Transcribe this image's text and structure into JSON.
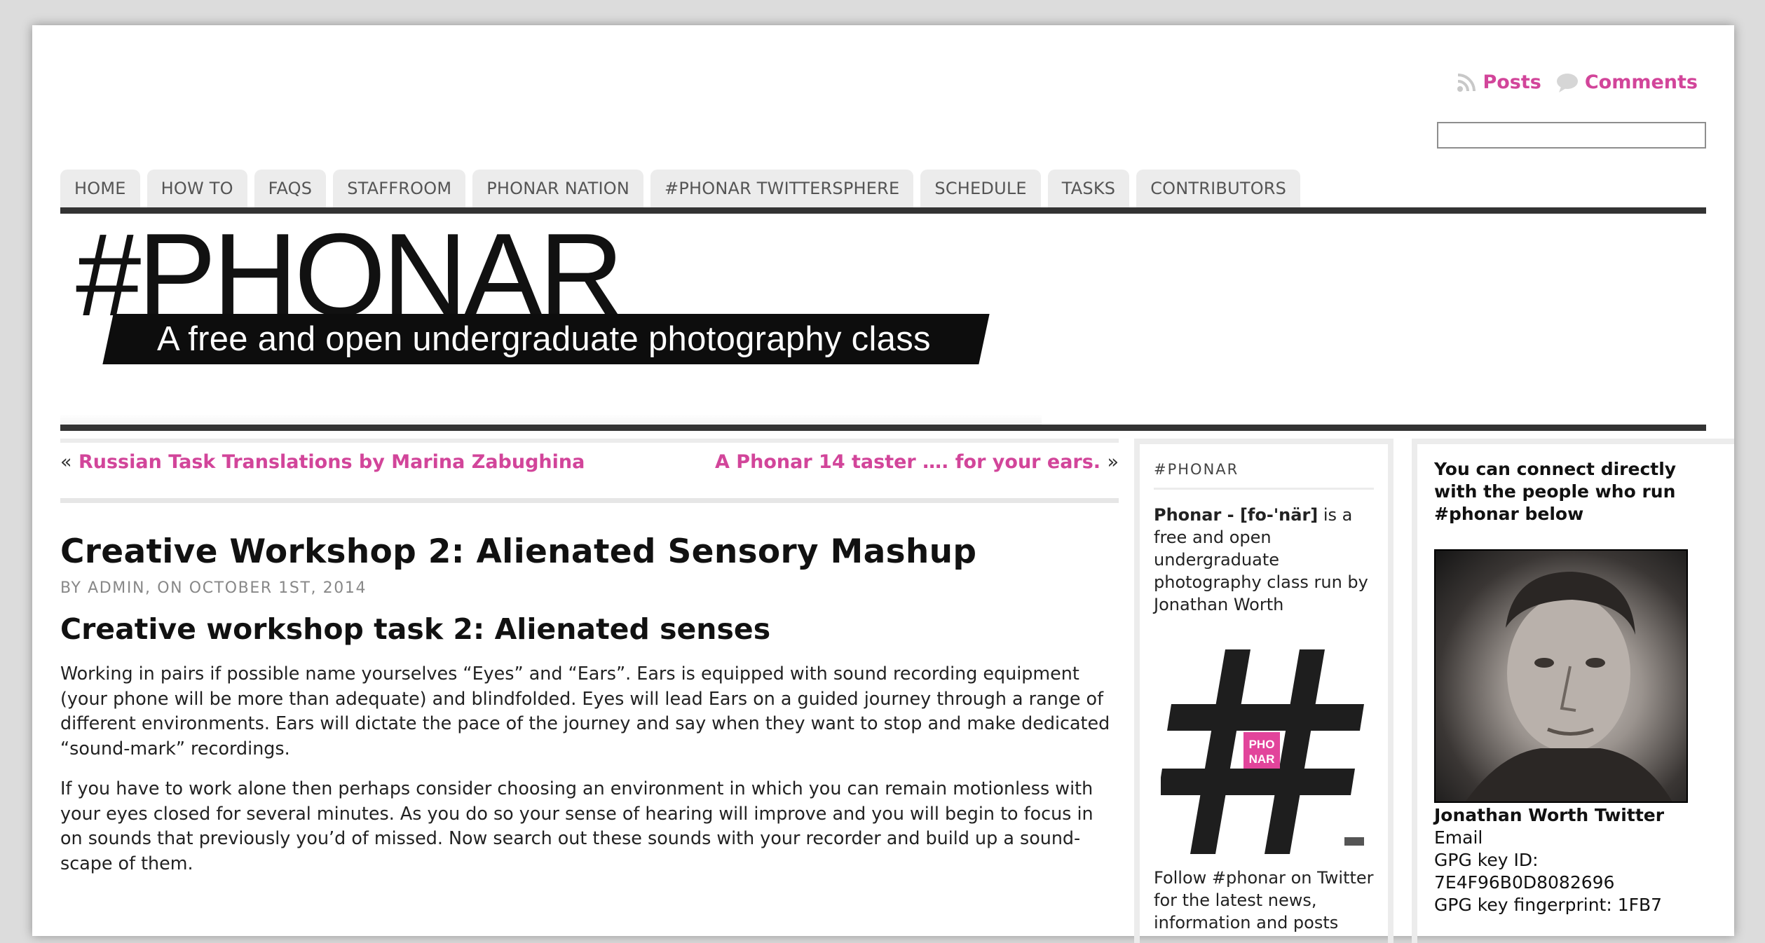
{
  "header": {
    "posts_label": "Posts",
    "comments_label": "Comments",
    "search_placeholder": ""
  },
  "nav": {
    "items": [
      "HOME",
      "HOW TO",
      "FAQS",
      "STAFFROOM",
      "PHONAR NATION",
      "#PHONAR TWITTERSPHERE",
      "SCHEDULE",
      "TASKS",
      "CONTRIBUTORS"
    ]
  },
  "banner": {
    "title": "#PHONAR",
    "subtitle": "A free and open undergraduate photography class"
  },
  "postnav": {
    "prev_arrow": "«",
    "prev_label": "Russian Task Translations by Marina Zabughina",
    "next_label": "A Phonar 14 taster …. for your ears.",
    "next_arrow": "»"
  },
  "post": {
    "title": "Creative Workshop 2: Alienated Sensory Mashup",
    "meta": "BY ADMIN, ON OCTOBER 1ST, 2014",
    "subtitle": "Creative workshop task 2: Alienated senses",
    "paragraphs": [
      "Working in pairs if possible name yourselves “Eyes” and “Ears”. Ears is equipped with sound recording equipment (your phone will be more than adequate) and blindfolded. Eyes will lead Ears on a guided journey through a range of different environments. Ears will dictate the pace of the journey and say when they want to stop and make dedicated “sound-mark” recordings.",
      "If you have to work alone then perhaps consider choosing an environment in which you can remain motionless with your eyes closed for several minutes. As you do so your sense of hearing will improve and you will begin to focus in on sounds that previously you’d of missed. Now search out these sounds with your recorder and build up a sound-scape of them."
    ]
  },
  "sidebar1": {
    "heading": "#PHONAR",
    "intro_bold": "Phonar - [fo-'när]",
    "intro_rest": " is a free and open undergraduate photography class run by Jonathan Worth",
    "badge_text_1": "PHO",
    "badge_text_2": "NAR",
    "follow_text": "Follow #phonar on Twitter for the latest news, information and posts"
  },
  "sidebar2": {
    "heading": "You can connect directly with the people who run #phonar below",
    "twitter_label": "Jonathan Worth Twitter",
    "email_label": "Email",
    "gpg_id_label": "GPG key ID:",
    "gpg_id_value": "7E4F96B0D8082696",
    "gpg_fp_label": "GPG key fingerprint: 1FB7"
  },
  "colors": {
    "accent": "#d2459a",
    "nav_bg": "#ececec",
    "rule": "#333333"
  }
}
